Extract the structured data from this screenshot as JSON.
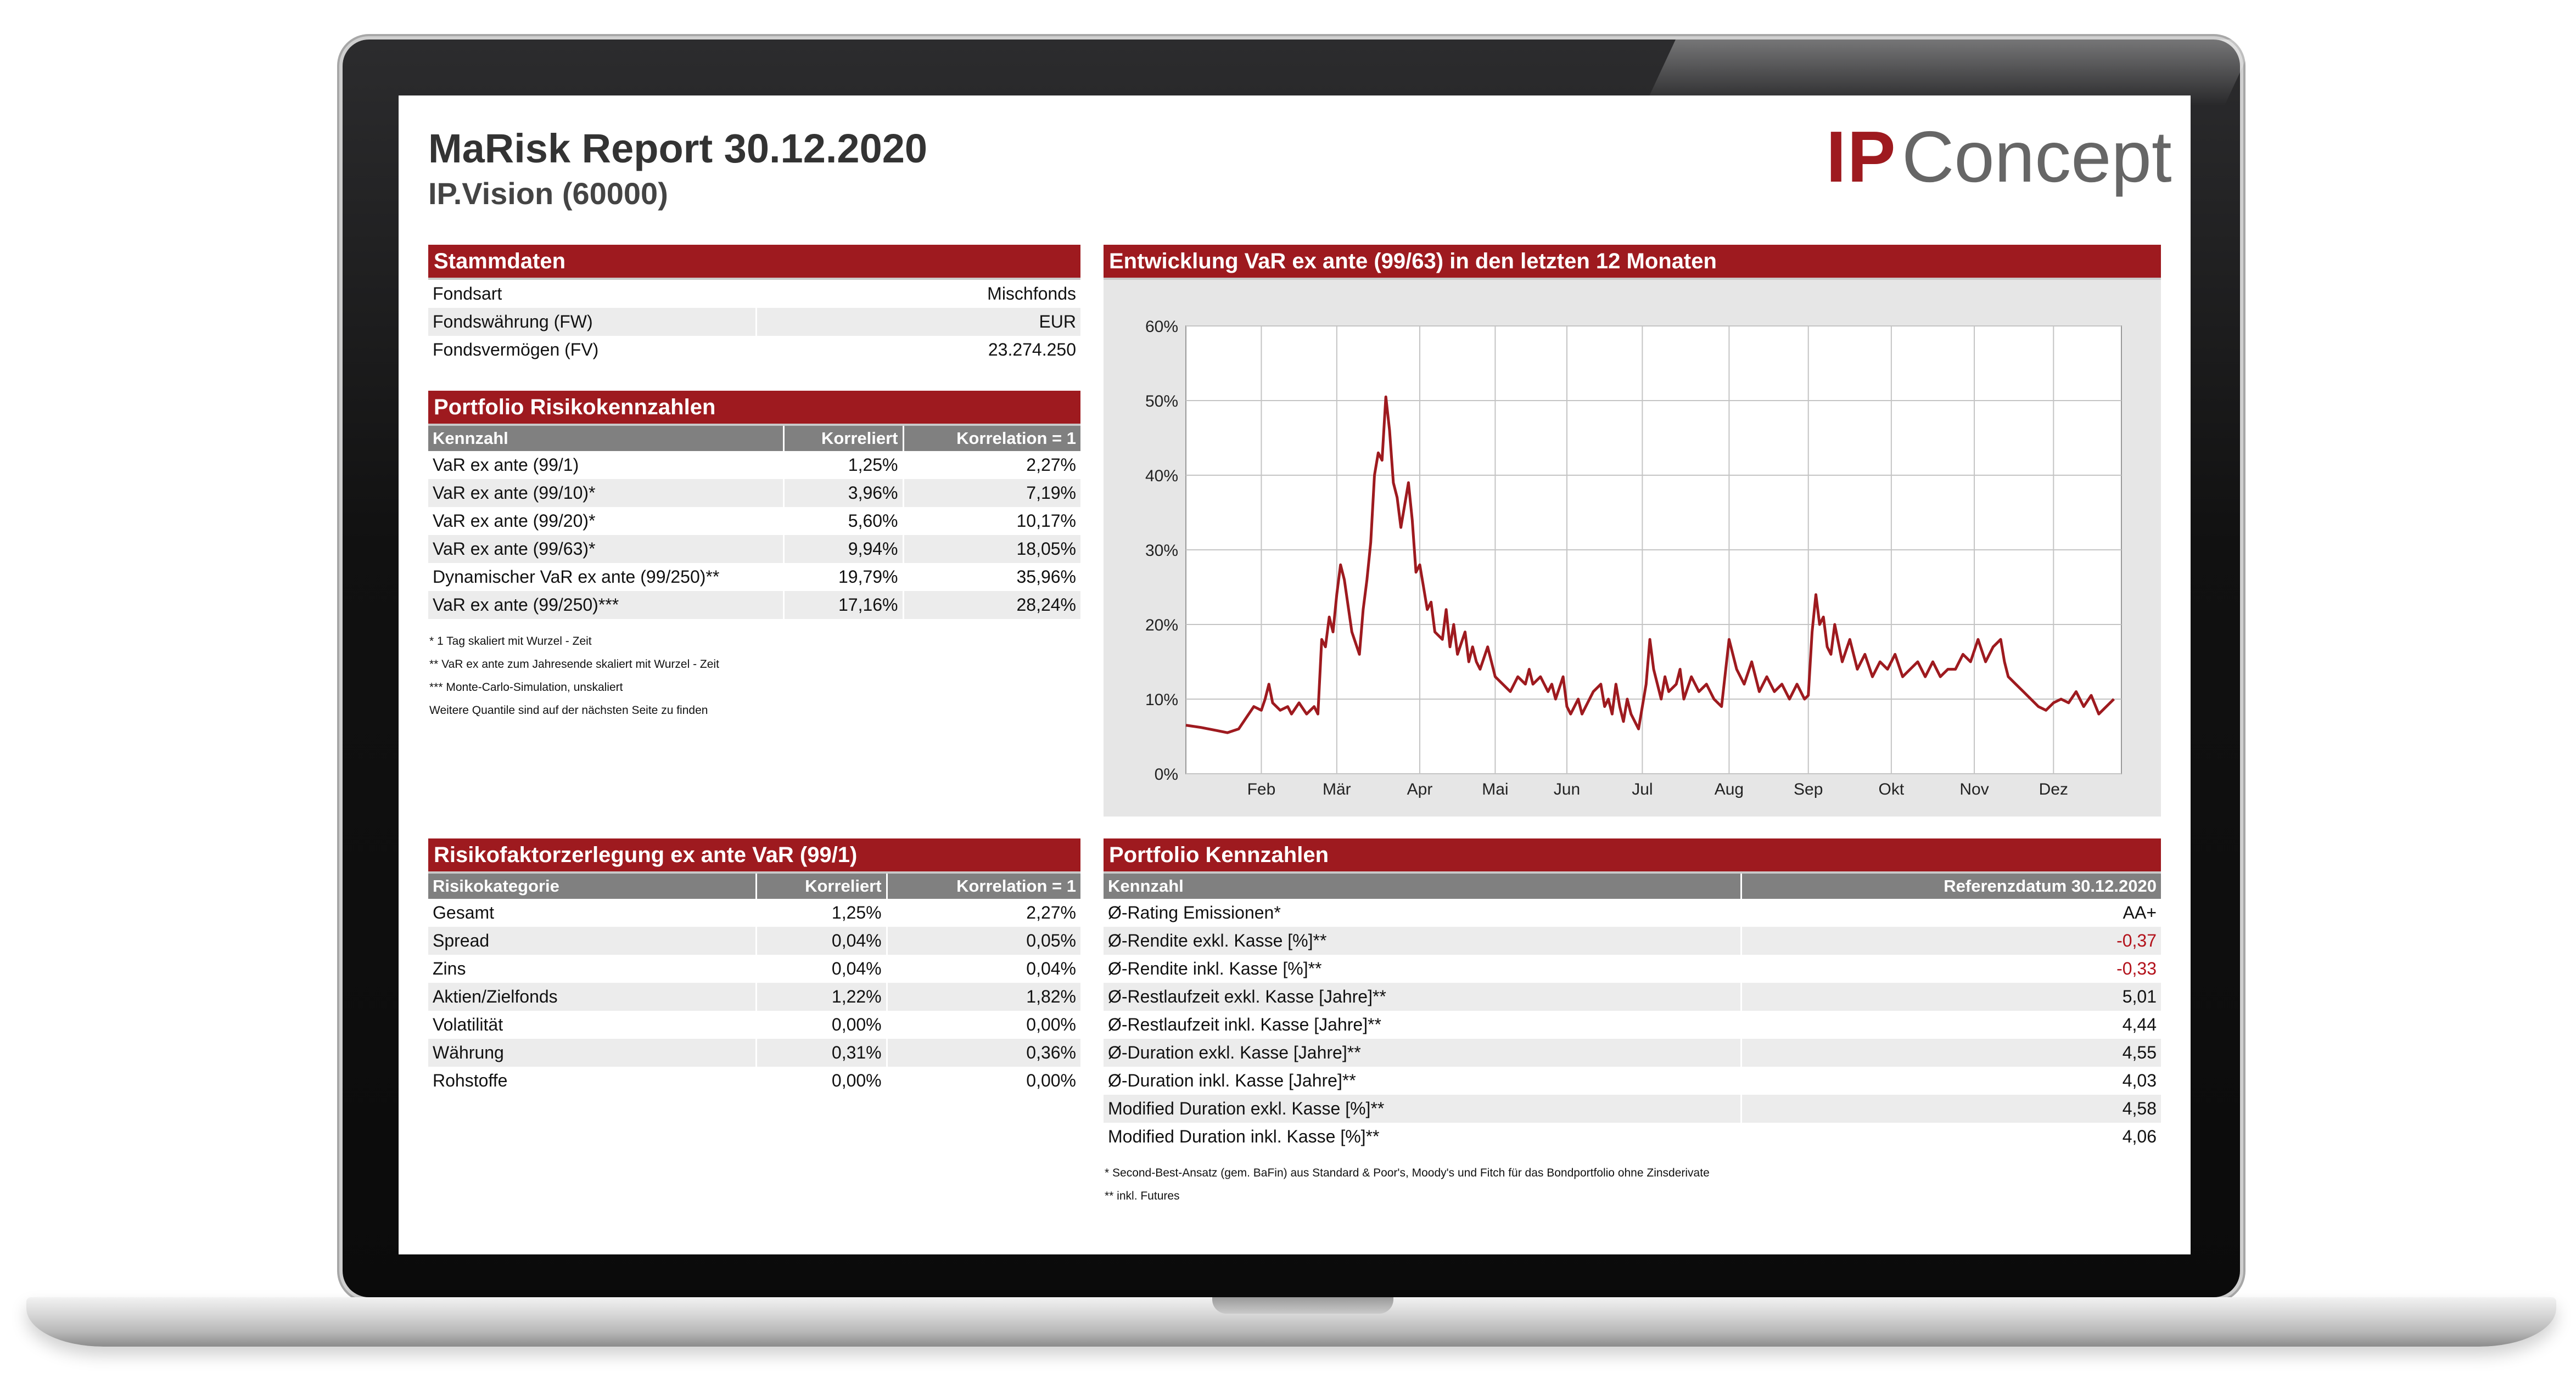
{
  "report": {
    "title": "MaRisk Report 30.12.2020",
    "subtitle": "IP.Vision (60000)",
    "logo_ip": "IP",
    "logo_concept": "Concept",
    "brand_color": "#9e1a1f"
  },
  "stammdaten": {
    "heading": "Stammdaten",
    "rows": [
      {
        "label": "Fondsart",
        "value": "Mischfonds"
      },
      {
        "label": "Fondswährung (FW)",
        "value": "EUR"
      },
      {
        "label": "Fondsvermögen (FV)",
        "value": "23.274.250"
      }
    ]
  },
  "risiko": {
    "heading": "Portfolio Risikokennzahlen",
    "columns": [
      "Kennzahl",
      "Korreliert",
      "Korrelation = 1"
    ],
    "rows": [
      {
        "label": "VaR ex ante (99/1)",
        "korreliert": "1,25%",
        "korr1": "2,27%"
      },
      {
        "label": "VaR ex ante (99/10)*",
        "korreliert": "3,96%",
        "korr1": "7,19%"
      },
      {
        "label": "VaR ex ante (99/20)*",
        "korreliert": "5,60%",
        "korr1": "10,17%"
      },
      {
        "label": "VaR ex ante (99/63)*",
        "korreliert": "9,94%",
        "korr1": "18,05%"
      },
      {
        "label": "Dynamischer VaR ex ante (99/250)**",
        "korreliert": "19,79%",
        "korr1": "35,96%"
      },
      {
        "label": "VaR ex ante (99/250)***",
        "korreliert": "17,16%",
        "korr1": "28,24%"
      }
    ],
    "notes": [
      "* 1 Tag skaliert mit Wurzel - Zeit",
      "** VaR ex ante zum Jahresende skaliert mit Wurzel - Zeit",
      "*** Monte-Carlo-Simulation, unskaliert",
      "Weitere Quantile sind auf der nächsten Seite zu finden"
    ]
  },
  "zerlegung": {
    "heading": "Risikofaktorzerlegung ex ante VaR (99/1)",
    "columns": [
      "Risikokategorie",
      "Korreliert",
      "Korrelation = 1"
    ],
    "rows": [
      {
        "label": "Gesamt",
        "korreliert": "1,25%",
        "korr1": "2,27%"
      },
      {
        "label": "Spread",
        "korreliert": "0,04%",
        "korr1": "0,05%"
      },
      {
        "label": "Zins",
        "korreliert": "0,04%",
        "korr1": "0,04%"
      },
      {
        "label": "Aktien/Zielfonds",
        "korreliert": "1,22%",
        "korr1": "1,82%"
      },
      {
        "label": "Volatilität",
        "korreliert": "0,00%",
        "korr1": "0,00%"
      },
      {
        "label": "Währung",
        "korreliert": "0,31%",
        "korr1": "0,36%"
      },
      {
        "label": "Rohstoffe",
        "korreliert": "0,00%",
        "korr1": "0,00%"
      }
    ]
  },
  "kennzahlen": {
    "heading": "Portfolio Kennzahlen",
    "columns": [
      "Kennzahl",
      "Referenzdatum 30.12.2020"
    ],
    "rows": [
      {
        "label": "Ø-Rating Emissionen*",
        "value": "AA+",
        "negative": false
      },
      {
        "label": "Ø-Rendite exkl. Kasse [%]**",
        "value": "-0,37",
        "negative": true
      },
      {
        "label": "Ø-Rendite inkl. Kasse [%]**",
        "value": "-0,33",
        "negative": true
      },
      {
        "label": "Ø-Restlaufzeit  exkl. Kasse [Jahre]**",
        "value": "5,01",
        "negative": false
      },
      {
        "label": "Ø-Restlaufzeit  inkl. Kasse [Jahre]**",
        "value": "4,44",
        "negative": false
      },
      {
        "label": "Ø-Duration exkl. Kasse [Jahre]**",
        "value": "4,55",
        "negative": false
      },
      {
        "label": "Ø-Duration inkl. Kasse [Jahre]**",
        "value": "4,03",
        "negative": false
      },
      {
        "label": "Modified Duration exkl. Kasse [%]**",
        "value": "4,58",
        "negative": false
      },
      {
        "label": "Modified Duration inkl. Kasse [%]**",
        "value": "4,06",
        "negative": false
      }
    ],
    "notes": [
      "* Second-Best-Ansatz (gem. BaFin) aus Standard & Poor's, Moody's und Fitch für das Bondportfolio ohne Zinsderivate",
      "** inkl. Futures"
    ]
  },
  "chart_data": {
    "type": "line",
    "title": "Entwicklung VaR ex ante (99/63) in den letzten 12 Monaten",
    "xlabel": "",
    "ylabel": "",
    "ylim": [
      0,
      60
    ],
    "yticks": [
      "0%",
      "10%",
      "20%",
      "30%",
      "40%",
      "50%",
      "60%"
    ],
    "xlim": [
      0,
      12.4
    ],
    "xticks": [
      {
        "label": "Feb",
        "x": 1
      },
      {
        "label": "Mär",
        "x": 2
      },
      {
        "label": "Apr",
        "x": 3.1
      },
      {
        "label": "Mai",
        "x": 4.1
      },
      {
        "label": "Jun",
        "x": 5.05
      },
      {
        "label": "Jul",
        "x": 6.05
      },
      {
        "label": "Aug",
        "x": 7.2
      },
      {
        "label": "Sep",
        "x": 8.25
      },
      {
        "label": "Okt",
        "x": 9.35
      },
      {
        "label": "Nov",
        "x": 10.45
      },
      {
        "label": "Dez",
        "x": 11.5
      }
    ],
    "grid": true,
    "line_color": "#9e1a1f",
    "series": [
      {
        "values": [
          [
            0,
            6.5
          ],
          [
            0.2,
            6.2
          ],
          [
            0.4,
            5.8
          ],
          [
            0.55,
            5.5
          ],
          [
            0.7,
            6
          ],
          [
            0.8,
            7.5
          ],
          [
            0.9,
            9
          ],
          [
            1.0,
            8.5
          ],
          [
            1.05,
            10
          ],
          [
            1.1,
            12
          ],
          [
            1.15,
            9.5
          ],
          [
            1.25,
            8.5
          ],
          [
            1.35,
            9
          ],
          [
            1.4,
            8
          ],
          [
            1.5,
            9.5
          ],
          [
            1.6,
            8
          ],
          [
            1.7,
            9
          ],
          [
            1.75,
            8
          ],
          [
            1.8,
            18
          ],
          [
            1.85,
            17
          ],
          [
            1.9,
            21
          ],
          [
            1.95,
            19
          ],
          [
            2.0,
            24
          ],
          [
            2.05,
            28
          ],
          [
            2.1,
            26
          ],
          [
            2.2,
            19
          ],
          [
            2.3,
            16
          ],
          [
            2.35,
            22
          ],
          [
            2.4,
            26
          ],
          [
            2.45,
            31
          ],
          [
            2.5,
            40
          ],
          [
            2.55,
            43
          ],
          [
            2.6,
            42
          ],
          [
            2.65,
            50.5
          ],
          [
            2.7,
            46
          ],
          [
            2.75,
            39
          ],
          [
            2.8,
            37
          ],
          [
            2.85,
            33
          ],
          [
            2.9,
            36
          ],
          [
            2.95,
            39
          ],
          [
            3.0,
            34
          ],
          [
            3.05,
            27
          ],
          [
            3.1,
            28
          ],
          [
            3.15,
            25
          ],
          [
            3.2,
            22
          ],
          [
            3.25,
            23
          ],
          [
            3.3,
            19
          ],
          [
            3.4,
            18
          ],
          [
            3.45,
            22
          ],
          [
            3.5,
            17
          ],
          [
            3.55,
            20
          ],
          [
            3.6,
            16
          ],
          [
            3.7,
            19
          ],
          [
            3.75,
            15
          ],
          [
            3.8,
            17
          ],
          [
            3.85,
            15
          ],
          [
            3.9,
            14
          ],
          [
            4.0,
            17
          ],
          [
            4.1,
            13
          ],
          [
            4.2,
            12
          ],
          [
            4.3,
            11
          ],
          [
            4.4,
            13
          ],
          [
            4.5,
            12
          ],
          [
            4.55,
            14
          ],
          [
            4.6,
            12
          ],
          [
            4.7,
            13
          ],
          [
            4.8,
            11
          ],
          [
            4.85,
            12
          ],
          [
            4.9,
            10
          ],
          [
            5.0,
            13
          ],
          [
            5.05,
            9
          ],
          [
            5.1,
            8
          ],
          [
            5.2,
            10
          ],
          [
            5.25,
            8
          ],
          [
            5.3,
            9
          ],
          [
            5.4,
            11
          ],
          [
            5.5,
            12
          ],
          [
            5.55,
            9
          ],
          [
            5.6,
            10
          ],
          [
            5.65,
            8
          ],
          [
            5.7,
            12
          ],
          [
            5.75,
            9
          ],
          [
            5.8,
            7
          ],
          [
            5.85,
            10
          ],
          [
            5.9,
            8
          ],
          [
            6.0,
            6
          ],
          [
            6.05,
            9
          ],
          [
            6.1,
            12
          ],
          [
            6.15,
            18
          ],
          [
            6.2,
            14
          ],
          [
            6.3,
            10
          ],
          [
            6.35,
            13
          ],
          [
            6.4,
            11
          ],
          [
            6.5,
            12
          ],
          [
            6.55,
            14
          ],
          [
            6.6,
            10
          ],
          [
            6.7,
            13
          ],
          [
            6.8,
            11
          ],
          [
            6.9,
            12
          ],
          [
            7.0,
            10
          ],
          [
            7.1,
            9
          ],
          [
            7.2,
            18
          ],
          [
            7.3,
            14
          ],
          [
            7.4,
            12
          ],
          [
            7.5,
            15
          ],
          [
            7.6,
            11
          ],
          [
            7.7,
            13
          ],
          [
            7.8,
            11
          ],
          [
            7.9,
            12
          ],
          [
            8.0,
            10
          ],
          [
            8.1,
            12
          ],
          [
            8.2,
            10
          ],
          [
            8.25,
            10.5
          ],
          [
            8.3,
            19
          ],
          [
            8.35,
            24
          ],
          [
            8.4,
            20
          ],
          [
            8.45,
            21
          ],
          [
            8.5,
            17
          ],
          [
            8.55,
            16
          ],
          [
            8.6,
            20
          ],
          [
            8.7,
            15
          ],
          [
            8.8,
            18
          ],
          [
            8.9,
            14
          ],
          [
            9.0,
            16
          ],
          [
            9.1,
            13
          ],
          [
            9.2,
            15
          ],
          [
            9.3,
            14
          ],
          [
            9.4,
            16
          ],
          [
            9.5,
            13
          ],
          [
            9.6,
            14
          ],
          [
            9.7,
            15
          ],
          [
            9.8,
            13
          ],
          [
            9.9,
            15
          ],
          [
            10.0,
            13
          ],
          [
            10.1,
            14
          ],
          [
            10.2,
            14
          ],
          [
            10.3,
            16
          ],
          [
            10.4,
            15
          ],
          [
            10.5,
            18
          ],
          [
            10.6,
            15
          ],
          [
            10.7,
            17
          ],
          [
            10.8,
            18
          ],
          [
            10.85,
            15
          ],
          [
            10.9,
            13
          ],
          [
            11.0,
            12
          ],
          [
            11.1,
            11
          ],
          [
            11.2,
            10
          ],
          [
            11.3,
            9
          ],
          [
            11.4,
            8.5
          ],
          [
            11.5,
            9.5
          ],
          [
            11.6,
            10
          ],
          [
            11.7,
            9.5
          ],
          [
            11.8,
            11
          ],
          [
            11.9,
            9
          ],
          [
            12.0,
            10.5
          ],
          [
            12.1,
            8
          ],
          [
            12.2,
            9
          ],
          [
            12.3,
            10
          ]
        ]
      }
    ]
  }
}
